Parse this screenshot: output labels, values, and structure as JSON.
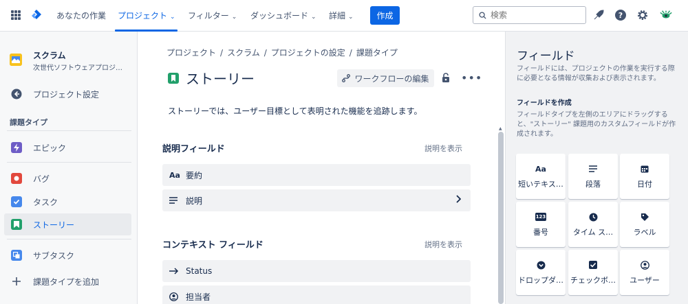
{
  "nav": {
    "your_work": "あなたの作業",
    "projects": "プロジェクト",
    "filters": "フィルター",
    "dashboards": "ダッシュボード",
    "more": "詳細",
    "create": "作成",
    "search_placeholder": "検索"
  },
  "sidebar": {
    "project_name": "スクラム",
    "project_sub": "次世代ソフトウェアプロジ…",
    "project_settings": "プロジェクト設定",
    "section": "課題タイプ",
    "items": [
      {
        "label": "エピック",
        "color": "#6e5dc6"
      },
      {
        "label": "バグ",
        "color": "#e2483d"
      },
      {
        "label": "タスク",
        "color": "#4688ec"
      },
      {
        "label": "ストーリー",
        "color": "#22a06b"
      },
      {
        "label": "サブタスク",
        "color": "#4688ec"
      }
    ],
    "add_type": "課題タイプを追加"
  },
  "main": {
    "breadcrumb": [
      "プロジェクト",
      "スクラム",
      "プロジェクトの設定",
      "課題タイプ"
    ],
    "title": "ストーリー",
    "workflow_button": "ワークフローの編集",
    "description": "ストーリーでは、ユーザー目標として表明された機能を追跡します。",
    "description_fields": {
      "title": "説明フィールド",
      "show_link": "説明を表示",
      "rows": [
        {
          "icon": "Aa",
          "label": "要約"
        },
        {
          "icon": "paragraph-icon",
          "label": "説明"
        }
      ]
    },
    "context_fields": {
      "title": "コンテキスト フィールド",
      "show_link": "説明を表示",
      "rows": [
        {
          "icon": "arrow-right-icon",
          "label": "Status"
        },
        {
          "icon": "user-icon",
          "label": "担当者"
        }
      ]
    }
  },
  "panel": {
    "title": "フィールド",
    "desc": "フィールドには、プロジェクトの作業を実行する際に必要となる情報が収集および表示されます。",
    "create_title": "フィールドを作成",
    "create_desc": "フィールドタイプを左側のエリアにドラッグすると、\"ストーリー\" 課題用のカスタムフィールドが作成されます。",
    "tiles": [
      {
        "icon": "Aa",
        "label": "短いテキス…"
      },
      {
        "icon": "paragraph-icon",
        "label": "段落"
      },
      {
        "icon": "calendar-icon",
        "label": "日付"
      },
      {
        "icon": "123",
        "label": "番号"
      },
      {
        "icon": "clock-icon",
        "label": "タイム ス…"
      },
      {
        "icon": "label-icon",
        "label": "ラベル"
      },
      {
        "icon": "dropdown-icon",
        "label": "ドロップダ…"
      },
      {
        "icon": "checkbox-icon",
        "label": "チェックボ…"
      },
      {
        "icon": "user-icon",
        "label": "ユーザー"
      }
    ]
  }
}
